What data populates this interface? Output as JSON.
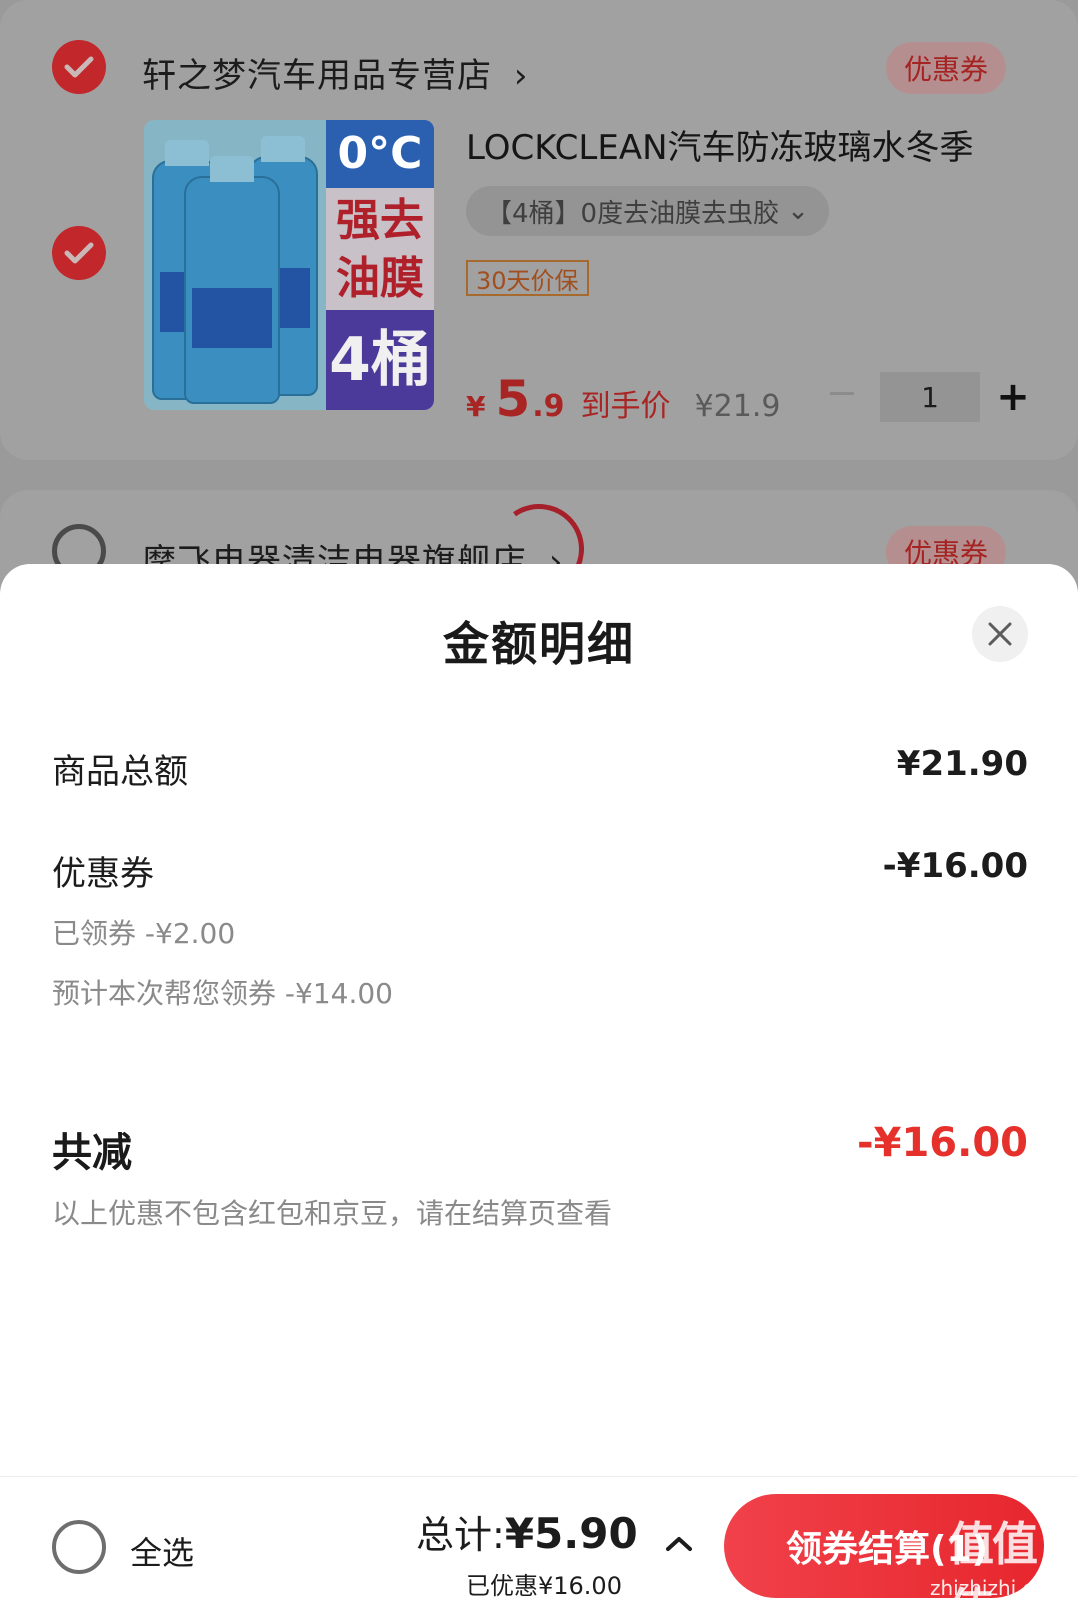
{
  "cart": {
    "store1": {
      "name": "轩之梦汽车用品专营店",
      "chevron": "›",
      "coupon_label": "优惠券"
    },
    "product": {
      "title": "LOCKCLEAN汽车防冻玻璃水冬季",
      "spec": "【4桶】0度去油膜去虫胶",
      "spec_chevron": "⌄",
      "price_protect": "30天价保",
      "price_symbol": "¥",
      "price_int": "5",
      "price_dec": ".9",
      "price_tag": "到手价",
      "original_price": "¥21.9",
      "quantity": "1",
      "plus": "+",
      "image": {
        "promo_temp": "0°C",
        "promo_text": "强去油膜",
        "promo_count": "4桶"
      }
    },
    "store2": {
      "name": "摩飞电器清洁电器旗舰店",
      "chevron": "›",
      "coupon_label": "优惠券"
    }
  },
  "sheet": {
    "title": "金额明细",
    "goods_total_label": "商品总额",
    "goods_total_value": "¥21.90",
    "coupon_label": "优惠券",
    "coupon_value": "-¥16.00",
    "claimed_label": "已领券 -¥2.00",
    "estimated_label": "预计本次帮您领券 -¥14.00",
    "total_reduce_label": "共减",
    "total_reduce_value": "-¥16.00",
    "note": "以上优惠不包含红包和京豆，请在结算页查看"
  },
  "bottom_bar": {
    "select_all": "全选",
    "total_label": "总计:",
    "total_value": "¥5.90",
    "saved": "已优惠¥16.00",
    "checkout": "领券结算(1)"
  },
  "watermark": {
    "logo": "值值值",
    "url": "zhizhizhi.com"
  },
  "colors": {
    "accent": "#e5302c",
    "overlay": "#9a9a9a",
    "sheet_bg": "#ffffff"
  }
}
